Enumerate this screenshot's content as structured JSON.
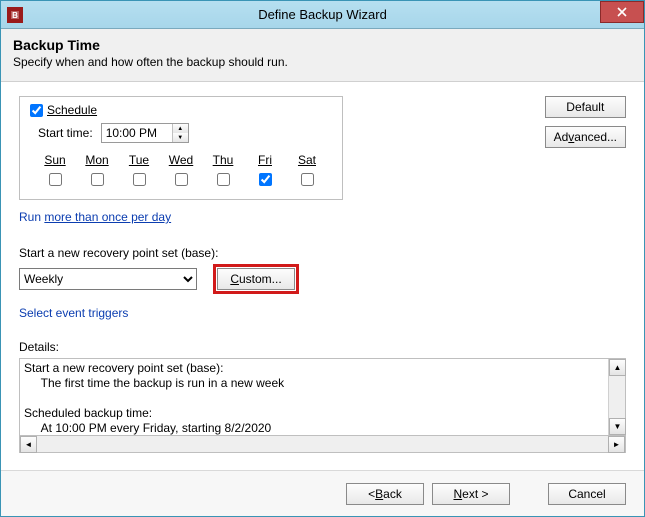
{
  "window": {
    "title": "Define Backup Wizard"
  },
  "header": {
    "title": "Backup Time",
    "subtitle": "Specify when and how often the backup should run."
  },
  "schedule": {
    "checkbox_label": "Schedule",
    "checked": true,
    "start_label": "Start time:",
    "start_value": "10:00 PM",
    "days": [
      {
        "label": "Sun",
        "checked": false
      },
      {
        "label": "Mon",
        "checked": false
      },
      {
        "label": "Tue",
        "checked": false
      },
      {
        "label": "Wed",
        "checked": false
      },
      {
        "label": "Thu",
        "checked": false
      },
      {
        "label": "Fri",
        "checked": true
      },
      {
        "label": "Sat",
        "checked": false
      }
    ],
    "more_link_prefix": "Run ",
    "more_link_underlined": "more than once per day"
  },
  "side": {
    "default": "Default",
    "advanced_pre": "Ad",
    "advanced_mn": "v",
    "advanced_post": "anced..."
  },
  "recovery": {
    "label": "Start a new recovery point set (base):",
    "selected": "Weekly",
    "options": [
      "Weekly"
    ],
    "custom_mn": "C",
    "custom_post": "ustom...",
    "event_link": "Select event triggers"
  },
  "details": {
    "label": "Details:",
    "text": "Start a new recovery point set (base):\n     The first time the backup is run in a new week\n\nScheduled backup time:\n     At 10:00 PM every Friday, starting 8/2/2020"
  },
  "footer": {
    "back_pre": "< ",
    "back_mn": "B",
    "back_post": "ack",
    "next_mn": "N",
    "next_post": "ext >",
    "cancel": "Cancel"
  }
}
